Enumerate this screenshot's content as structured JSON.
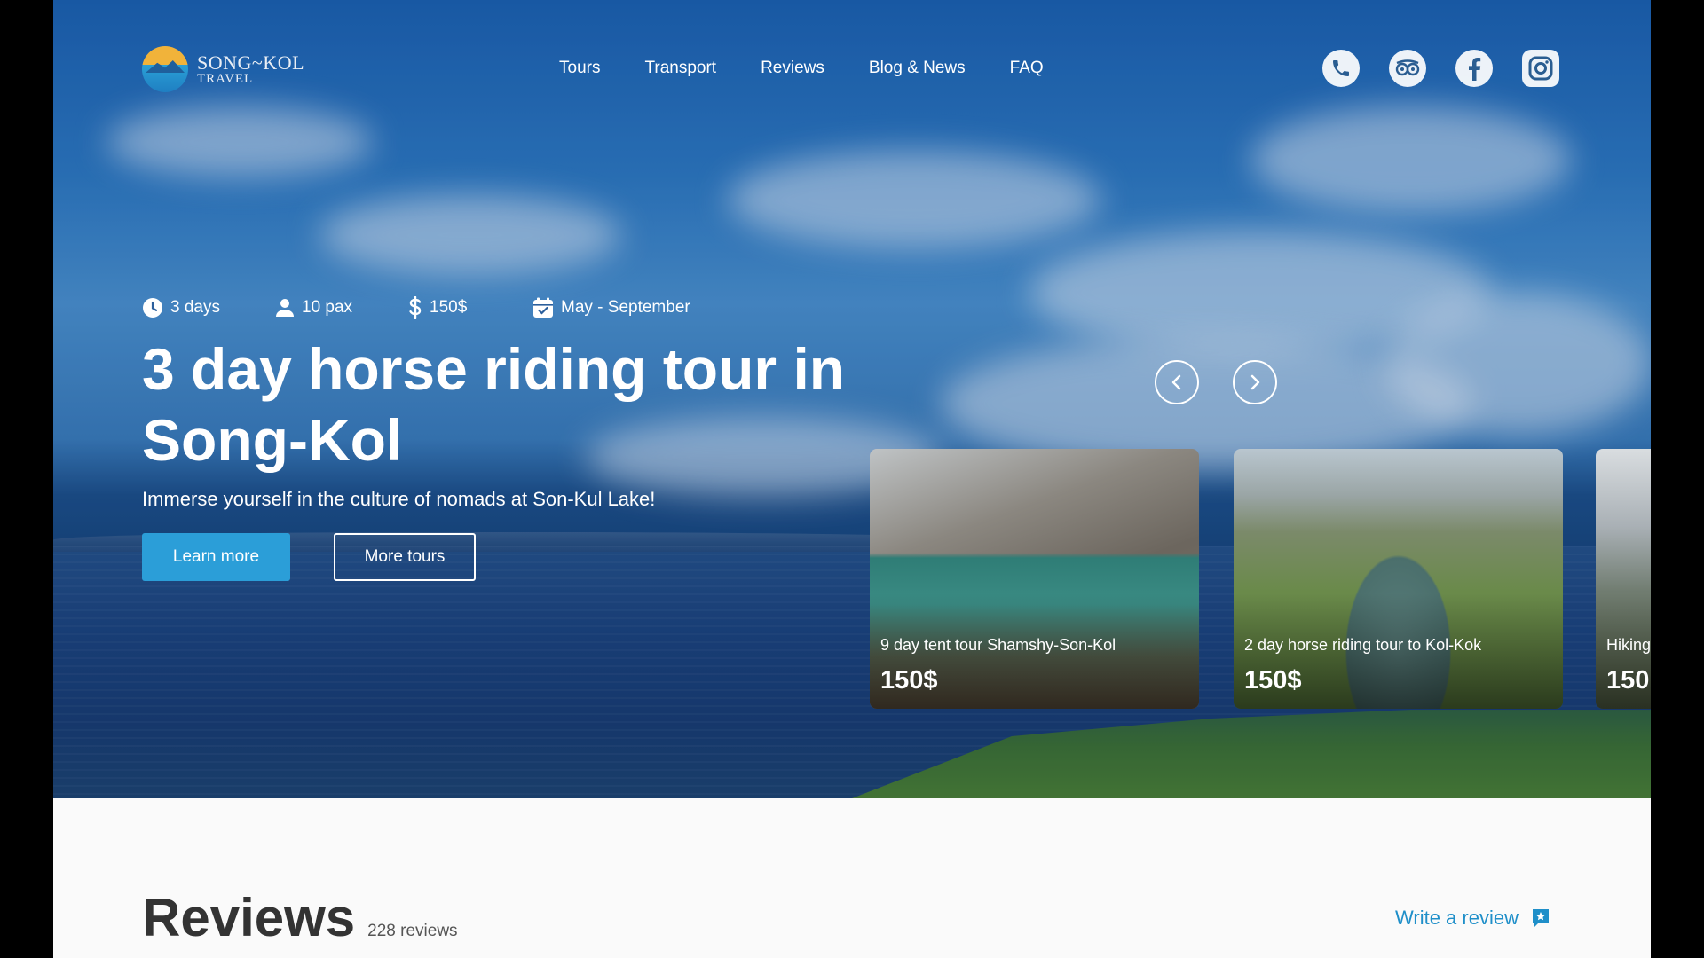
{
  "brand": {
    "name_line1": "SONG~KOL",
    "name_line2": "TRAVEL"
  },
  "nav": {
    "items": [
      "Tours",
      "Transport",
      "Reviews",
      "Blog & News",
      "FAQ"
    ]
  },
  "socials": [
    "whatsapp-icon",
    "tripadvisor-icon",
    "facebook-icon",
    "instagram-icon"
  ],
  "hero": {
    "meta": {
      "duration": "3 days",
      "pax": "10 pax",
      "price": "150$",
      "season": "May - September"
    },
    "title": "3 day horse riding tour in Song-Kol",
    "subtitle": "Immerse yourself in the culture of nomads at Son-Kul Lake!",
    "learn_more": "Learn more",
    "more_tours": "More tours"
  },
  "tour_cards": [
    {
      "title": "9 day tent tour Shamshy-Son-Kol",
      "price": "150$"
    },
    {
      "title": "2 day horse riding tour to Kol-Kok",
      "price": "150$"
    },
    {
      "title": "Hiking",
      "price": "150"
    }
  ],
  "reviews": {
    "title": "Reviews",
    "count": "228 reviews",
    "write": "Write a review"
  },
  "colors": {
    "accent": "#2b9ed8",
    "link": "#1f8fc9"
  }
}
